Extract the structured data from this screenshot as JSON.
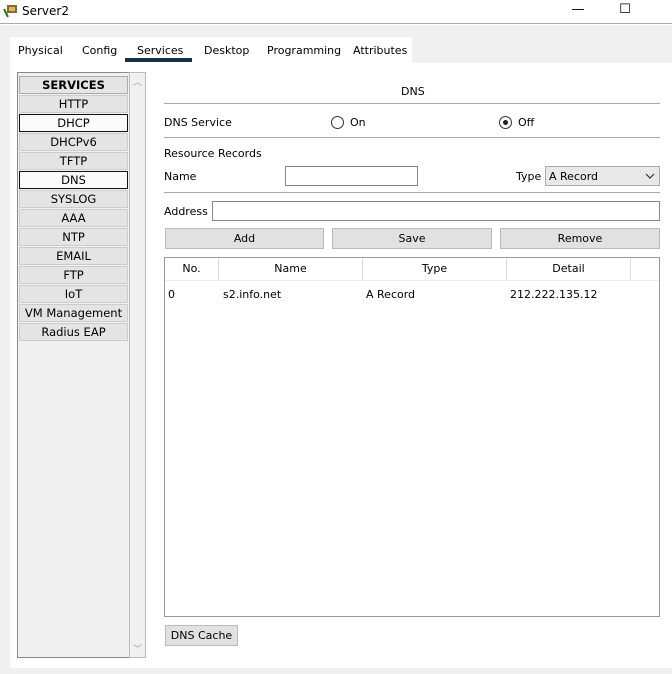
{
  "window": {
    "title": "Server2",
    "minimize": "—",
    "maximize": "☐"
  },
  "tabs": [
    {
      "label": "Physical"
    },
    {
      "label": "Config"
    },
    {
      "label": "Services",
      "active": true
    },
    {
      "label": "Desktop"
    },
    {
      "label": "Programming"
    },
    {
      "label": "Attributes"
    }
  ],
  "sidebar": {
    "header": "SERVICES",
    "items": [
      "HTTP",
      "DHCP",
      "DHCPv6",
      "TFTP",
      "DNS",
      "SYSLOG",
      "AAA",
      "NTP",
      "EMAIL",
      "FTP",
      "IoT",
      "VM Management",
      "Radius EAP"
    ],
    "selected": "DNS"
  },
  "dns": {
    "title": "DNS",
    "service_label": "DNS Service",
    "on_label": "On",
    "off_label": "Off",
    "service_state": "Off",
    "resource_records_label": "Resource Records",
    "name_label": "Name",
    "name_value": "",
    "type_label": "Type",
    "type_value": "A Record",
    "address_label": "Address",
    "address_value": "",
    "add": "Add",
    "save": "Save",
    "remove": "Remove",
    "columns": [
      "No.",
      "Name",
      "Type",
      "Detail"
    ],
    "rows": [
      {
        "no": "0",
        "name": "s2.info.net",
        "type": "A Record",
        "detail": "212.222.135.12"
      }
    ],
    "cache_button": "DNS Cache"
  },
  "colors": {
    "tab_underline": "#1b3048"
  }
}
